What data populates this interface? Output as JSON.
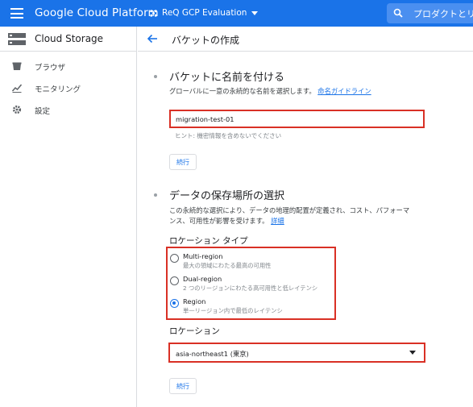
{
  "topbar": {
    "brand": "Google Cloud Platform",
    "project": "ReQ GCP Evaluation",
    "search_placeholder": "プロダクトとリ",
    "accent": "#1a73e8"
  },
  "sidebar": {
    "title": "Cloud Storage",
    "items": [
      {
        "label": "ブラウザ",
        "icon": "bucket-icon"
      },
      {
        "label": "モニタリング",
        "icon": "monitoring-icon"
      },
      {
        "label": "設定",
        "icon": "gear-icon"
      }
    ]
  },
  "header": {
    "title": "バケットの作成"
  },
  "section1": {
    "title": "バケットに名前を付ける",
    "desc": "グローバルに一意の永続的な名前を選択します。",
    "link": "命名ガイドライン",
    "input_value": "migration-test-01",
    "hint": "ヒント: 機密情報を含めないでください",
    "continue": "続行"
  },
  "section2": {
    "title": "データの保存場所の選択",
    "desc_line1": "この永続的な選択により、データの地理的配置が定義され、コスト、パフォーマ",
    "desc_line2": "ンス、可用性が影響を受けます。",
    "link": "詳細",
    "location_type_label": "ロケーション タイプ",
    "options": [
      {
        "title": "Multi-region",
        "sub": "最大の領域にわたる最高の可用性",
        "selected": false
      },
      {
        "title": "Dual-region",
        "sub": "2 つのリージョンにわたる高可用性と低レイテンシ",
        "selected": false
      },
      {
        "title": "Region",
        "sub": "単一リージョン内で最低のレイテンシ",
        "selected": true
      }
    ],
    "location_label": "ロケーション",
    "location_value": "asia-northeast1 (東京)",
    "continue": "続行"
  },
  "highlight_color": "#d93025"
}
